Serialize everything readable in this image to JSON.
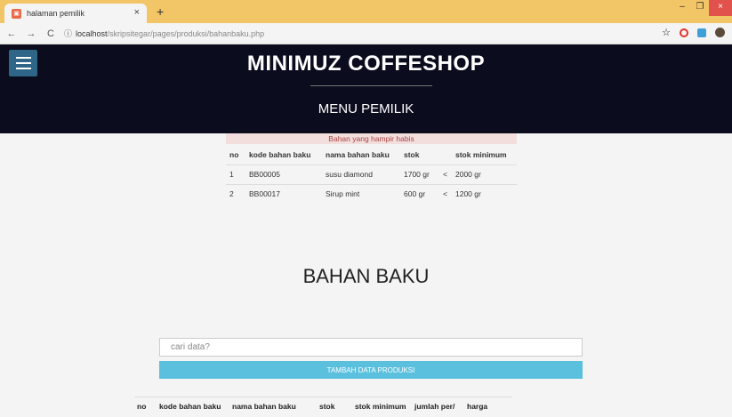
{
  "browser": {
    "tab_title": "halaman pemilik",
    "tab_close": "×",
    "new_tab": "+",
    "url_host": "localhost",
    "url_path": "/skripsitegar/pages/produksi/bahanbaku.php",
    "win_minimize": "–",
    "win_restore": "❐",
    "win_close": "×",
    "nav_back": "←",
    "nav_forward": "→",
    "nav_reload": "C",
    "bookmark": "☆"
  },
  "header": {
    "brand": "MINIMUZ COFFESHOP",
    "menu": "MENU PEMILIK"
  },
  "alert": {
    "text": "Bahan yang hampir habis",
    "columns": [
      "no",
      "kode bahan baku",
      "nama bahan baku",
      "stok",
      "",
      "stok minimum"
    ],
    "rows": [
      [
        "1",
        "BB00005",
        "susu diamond",
        "1700 gr",
        "<",
        "2000 gr"
      ],
      [
        "2",
        "BB00017",
        "Sirup mint",
        "600 gr",
        "<",
        "1200 gr"
      ]
    ]
  },
  "main": {
    "title": "BAHAN BAKU",
    "search_placeholder": "cari data?",
    "add_button": "TAMBAH DATA PRODUKSI",
    "columns": [
      "no",
      "kode bahan baku",
      "nama bahan baku",
      "stok",
      "stok minimum",
      "jumlah per/",
      "harga"
    ]
  },
  "colors": {
    "header_bg": "#0b0c1e",
    "accent": "#5bc0de",
    "alert_bg": "#f3dede",
    "tabbar": "#f2c566"
  }
}
